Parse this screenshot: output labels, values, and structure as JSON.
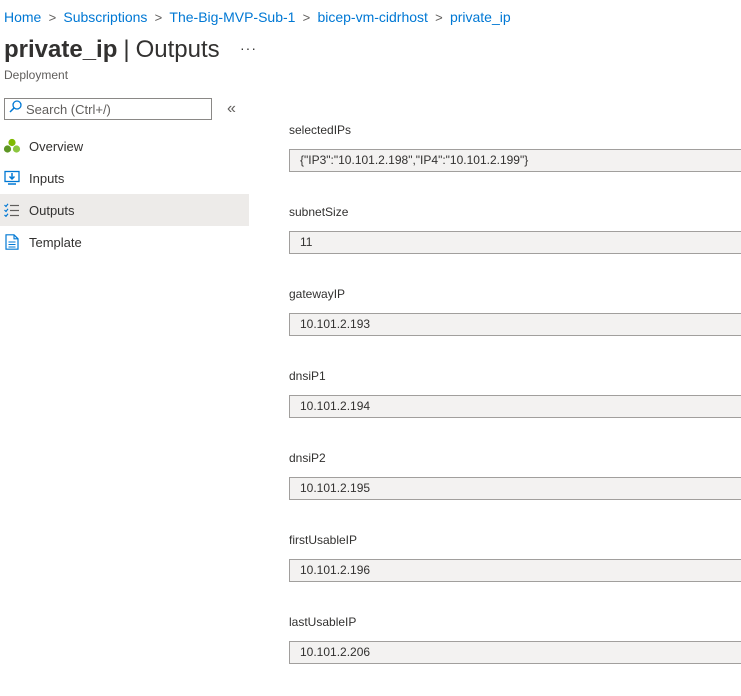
{
  "breadcrumb": {
    "items": [
      "Home",
      "Subscriptions",
      "The-Big-MVP-Sub-1",
      "bicep-vm-cidrhost",
      "private_ip"
    ],
    "separator": ">"
  },
  "header": {
    "title_bold": "private_ip",
    "title_sep": "|",
    "title_rest": "Outputs",
    "more": "···",
    "subtitle": "Deployment"
  },
  "search": {
    "placeholder": "Search (Ctrl+/)",
    "value": ""
  },
  "sidebar": {
    "collapse_glyph": "«",
    "items": [
      {
        "label": "Overview",
        "icon": "overview-icon"
      },
      {
        "label": "Inputs",
        "icon": "inputs-icon"
      },
      {
        "label": "Outputs",
        "icon": "outputs-icon",
        "active": true
      },
      {
        "label": "Template",
        "icon": "template-icon"
      }
    ]
  },
  "outputs": [
    {
      "label": "selectedIPs",
      "value": "{\"IP3\":\"10.101.2.198\",\"IP4\":\"10.101.2.199\"}"
    },
    {
      "label": "subnetSize",
      "value": "11"
    },
    {
      "label": "gatewayIP",
      "value": "10.101.2.193"
    },
    {
      "label": "dnsiP1",
      "value": "10.101.2.194"
    },
    {
      "label": "dnsiP2",
      "value": "10.101.2.195"
    },
    {
      "label": "firstUsableIP",
      "value": "10.101.2.196"
    },
    {
      "label": "lastUsableIP",
      "value": "10.101.2.206"
    }
  ],
  "colors": {
    "link": "#0078d4",
    "active_nav_bg": "#edebe9",
    "readonly_field_bg": "#f3f2f1"
  }
}
